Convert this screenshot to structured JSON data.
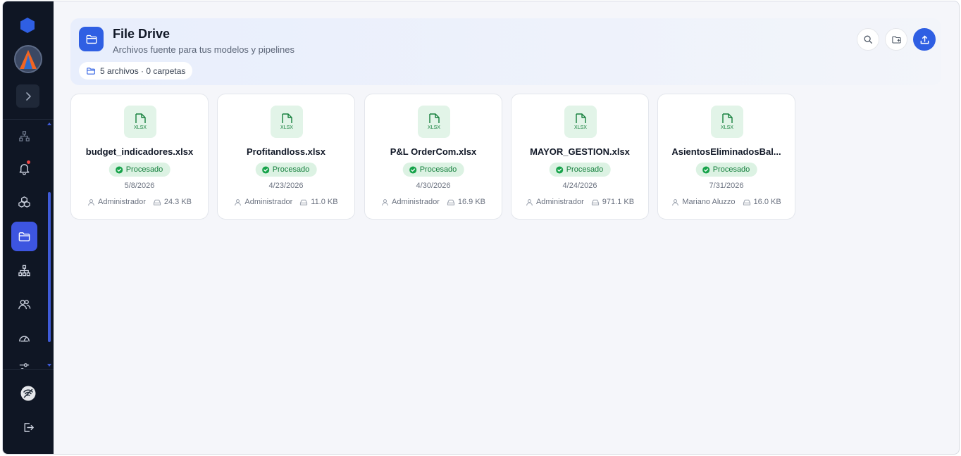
{
  "sidebar": {
    "logo_icon": "hexagon-logo-icon",
    "brand_color": "#2f5fe3",
    "nav_items": [
      {
        "name": "hierarchy-icon"
      },
      {
        "name": "bell-icon",
        "has_notification": true
      },
      {
        "name": "cubes-icon"
      },
      {
        "name": "folder-icon",
        "active": true
      },
      {
        "name": "sitemap-icon"
      },
      {
        "name": "users-icon"
      },
      {
        "name": "gauge-icon"
      },
      {
        "name": "sliders-icon"
      }
    ],
    "bottom_items": [
      {
        "name": "wifi-off-icon"
      },
      {
        "name": "logout-icon"
      }
    ]
  },
  "header": {
    "title": "File Drive",
    "subtitle": "Archivos fuente para tus modelos y pipelines",
    "stats": "5 archivos · 0 carpetas",
    "actions": [
      "search-icon",
      "new-folder-icon",
      "upload-icon"
    ]
  },
  "files": [
    {
      "name": "budget_indicadores.xlsx",
      "type": "XLSX",
      "status": "Procesado",
      "date": "5/8/2026",
      "owner": "Administrador",
      "size": "24.3 KB"
    },
    {
      "name": "Profitandloss.xlsx",
      "type": "XLSX",
      "status": "Procesado",
      "date": "4/23/2026",
      "owner": "Administrador",
      "size": "11.0 KB"
    },
    {
      "name": "P&L OrderCom.xlsx",
      "type": "XLSX",
      "status": "Procesado",
      "date": "4/30/2026",
      "owner": "Administrador",
      "size": "16.9 KB"
    },
    {
      "name": "MAYOR_GESTION.xlsx",
      "type": "XLSX",
      "status": "Procesado",
      "date": "4/24/2026",
      "owner": "Administrador",
      "size": "971.1 KB"
    },
    {
      "name": "AsientosEliminadosBal...",
      "type": "XLSX",
      "status": "Procesado",
      "date": "7/31/2026",
      "owner": "Mariano Aluzzo",
      "size": "16.0 KB"
    }
  ]
}
